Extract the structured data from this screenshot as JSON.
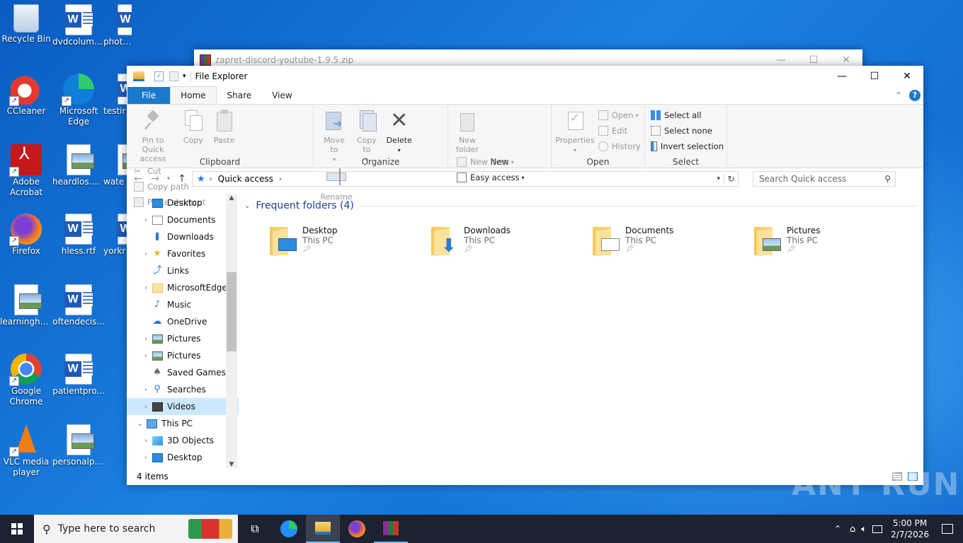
{
  "desktop": {
    "icons": [
      {
        "label": "Recycle Bin",
        "type": "recycle"
      },
      {
        "label": "dvdcolumb...",
        "type": "word"
      },
      {
        "label": "photograp...",
        "type": "word"
      },
      {
        "label": "CCleaner",
        "type": "ccleaner"
      },
      {
        "label": "Microsoft Edge",
        "type": "edge"
      },
      {
        "label": "testir",
        "type": "word"
      },
      {
        "label": "Adobe Acrobat",
        "type": "acrobat"
      },
      {
        "label": "heardlos.png",
        "type": "pic"
      },
      {
        "label": "wate",
        "type": "pic"
      },
      {
        "label": "Firefox",
        "type": "firefox"
      },
      {
        "label": "hless.rtf",
        "type": "word"
      },
      {
        "label": "yorkr",
        "type": "word"
      },
      {
        "label": "learninghu...",
        "type": "pic"
      },
      {
        "label": "oftendecis...",
        "type": "word"
      },
      {
        "label": "Google Chrome",
        "type": "chrome"
      },
      {
        "label": "patientpro...",
        "type": "word"
      },
      {
        "label": "VLC media player",
        "type": "vlc"
      },
      {
        "label": "personalpo...",
        "type": "pic"
      }
    ]
  },
  "back_window": {
    "title": "zapret-discord-youtube-1.9.5.zip"
  },
  "explorer": {
    "title": "File Explorer",
    "tabs": [
      "File",
      "Home",
      "Share",
      "View"
    ],
    "clipboard": {
      "pin": "Pin to Quick access",
      "copy": "Copy",
      "paste": "Paste",
      "cut": "Cut",
      "copy_path": "Copy path",
      "paste_shortcut": "Paste shortcut",
      "group": "Clipboard"
    },
    "organize": {
      "move": "Move to",
      "copy": "Copy to",
      "delete": "Delete",
      "rename": "Rename",
      "group": "Organize"
    },
    "new": {
      "new_folder": "New folder",
      "new_item": "New item",
      "easy_access": "Easy access",
      "group": "New"
    },
    "open": {
      "properties": "Properties",
      "open": "Open",
      "edit": "Edit",
      "history": "History",
      "group": "Open"
    },
    "select": {
      "select_all": "Select all",
      "select_none": "Select none",
      "invert": "Invert selection",
      "group": "Select"
    },
    "address": {
      "location": "Quick access",
      "search_placeholder": "Search Quick access"
    },
    "nav_items": [
      {
        "label": "Desktop",
        "expand": "",
        "indent": 1,
        "icon": "desktop"
      },
      {
        "label": "Documents",
        "expand": ">",
        "indent": 1,
        "icon": "docs"
      },
      {
        "label": "Downloads",
        "expand": "",
        "indent": 1,
        "icon": "down"
      },
      {
        "label": "Favorites",
        "expand": ">",
        "indent": 1,
        "icon": "star"
      },
      {
        "label": "Links",
        "expand": "",
        "indent": 1,
        "icon": "link"
      },
      {
        "label": "MicrosoftEdge",
        "expand": ">",
        "indent": 1,
        "icon": "folder"
      },
      {
        "label": "Music",
        "expand": "",
        "indent": 1,
        "icon": "music"
      },
      {
        "label": "OneDrive",
        "expand": "",
        "indent": 1,
        "icon": "cloud"
      },
      {
        "label": "Pictures",
        "expand": ">",
        "indent": 1,
        "icon": "pics"
      },
      {
        "label": "Pictures",
        "expand": ">",
        "indent": 1,
        "icon": "pics"
      },
      {
        "label": "Saved Games",
        "expand": "",
        "indent": 1,
        "icon": "games"
      },
      {
        "label": "Searches",
        "expand": ">",
        "indent": 1,
        "icon": "search"
      },
      {
        "label": "Videos",
        "expand": ">",
        "indent": 1,
        "icon": "video"
      },
      {
        "label": "This PC",
        "expand": "v",
        "indent": 0,
        "icon": "pc"
      },
      {
        "label": "3D Objects",
        "expand": ">",
        "indent": 1,
        "icon": "3d"
      },
      {
        "label": "Desktop",
        "expand": ">",
        "indent": 1,
        "icon": "desktop"
      }
    ],
    "section_title": "Frequent folders (4)",
    "folders": [
      {
        "name": "Desktop",
        "location": "This PC",
        "overlay": "desktop"
      },
      {
        "name": "Downloads",
        "location": "This PC",
        "overlay": "down"
      },
      {
        "name": "Documents",
        "location": "This PC",
        "overlay": "docs"
      },
      {
        "name": "Pictures",
        "location": "This PC",
        "overlay": "pics"
      }
    ],
    "status": "4 items"
  },
  "watermark": "ANY RUN",
  "taskbar": {
    "search_placeholder": "Type here to search",
    "time": "5:00 PM",
    "date": "2/7/2026"
  },
  "colors": {
    "accent": "#1979ca",
    "taskbar": "#1c2230",
    "selection": "#cce8ff"
  }
}
